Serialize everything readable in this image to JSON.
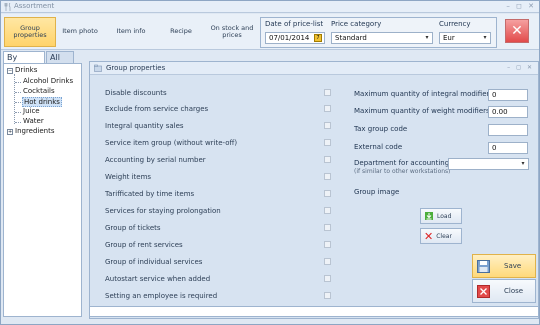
{
  "window": {
    "title": "Assortment"
  },
  "toolbar": {
    "buttons": [
      {
        "label": "Group properties"
      },
      {
        "label": "Item photo"
      },
      {
        "label": "Item info"
      },
      {
        "label": "Recipe"
      },
      {
        "label": "On stock and prices"
      }
    ],
    "price_date_label": "Date of price-list",
    "price_date_value": "07/01/2014",
    "price_category_label": "Price category",
    "price_category_value": "Standard",
    "currency_label": "Currency",
    "currency_value": "Eur"
  },
  "tabs": [
    {
      "label": "By groups"
    },
    {
      "label": "All list"
    }
  ],
  "tree": {
    "root": "Drinks",
    "children": [
      "Alcohol Drinks",
      "Cocktails",
      "Hot drinks",
      "Juice",
      "Water"
    ],
    "selected": "Hot drinks",
    "root2": "Ingredients"
  },
  "panel": {
    "title": "Group properties",
    "properties": [
      "Disable discounts",
      "Exclude from service charges",
      "Integral quantity sales",
      "Service item group (without write-off)",
      "Accounting by serial number",
      "Weight items",
      "Tarifficated by time items",
      "Services for staying prolongation",
      "Group of tickets",
      "Group of rent services",
      "Group of individual services",
      "Autostart service when added",
      "Setting an employee is required"
    ],
    "right": {
      "max_integral_label": "Maximum quantity of integral modifiers",
      "max_integral_value": "0",
      "max_weight_label": "Maximum quantity of weight modifiers",
      "max_weight_value": "0.00",
      "tax_label": "Tax group code",
      "tax_value": "",
      "external_label": "External code",
      "external_value": "0",
      "dept_label": "Department for accounting",
      "dept_hint": "(if similar to other workstations)",
      "dept_value": "",
      "image_label": "Group image",
      "load_label": "Load",
      "clear_label": "Clear"
    },
    "save_label": "Save",
    "close_label": "Close"
  },
  "colors": {
    "accent": "#ffd36a",
    "close": "#e24a4a",
    "selection": "#cfe2f7"
  }
}
